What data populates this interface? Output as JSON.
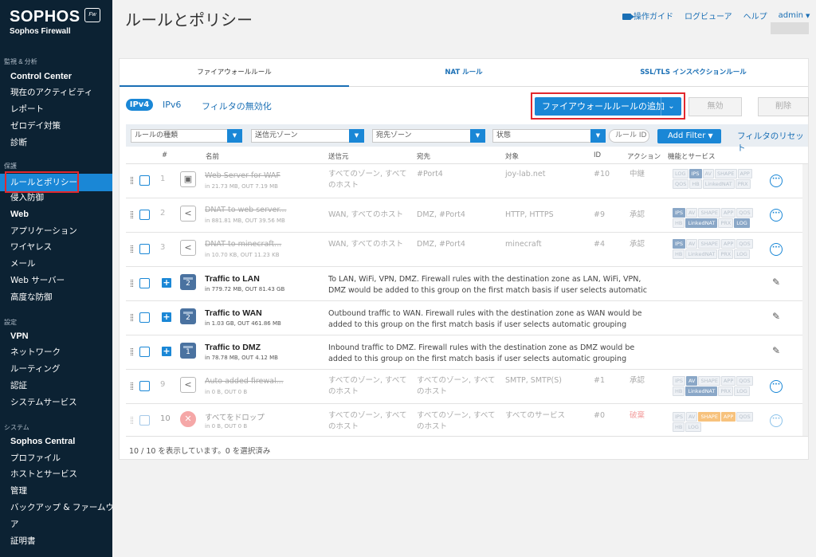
{
  "brand": {
    "name": "SOPHOS",
    "product": "Sophos Firewall",
    "badge": "Fw"
  },
  "sidebar": {
    "sections": [
      {
        "label": "監視 & 分析"
      },
      {
        "label": "保護"
      },
      {
        "label": "設定"
      },
      {
        "label": "システム"
      }
    ],
    "items": [
      {
        "label": "Control Center"
      },
      {
        "label": "現在のアクティビティ"
      },
      {
        "label": "レポート"
      },
      {
        "label": "ゼロデイ対策"
      },
      {
        "label": "診断"
      },
      {
        "label": "ルールとポリシー",
        "active": true
      },
      {
        "label": "侵入防御"
      },
      {
        "label": "Web"
      },
      {
        "label": "アプリケーション"
      },
      {
        "label": "ワイヤレス"
      },
      {
        "label": "メール"
      },
      {
        "label": "Web サーバー"
      },
      {
        "label": "高度な防御"
      },
      {
        "label": "VPN"
      },
      {
        "label": "ネットワーク"
      },
      {
        "label": "ルーティング"
      },
      {
        "label": "認証"
      },
      {
        "label": "システムサービス"
      },
      {
        "label": "Sophos Central"
      },
      {
        "label": "プロファイル"
      },
      {
        "label": "ホストとサービス"
      },
      {
        "label": "管理"
      },
      {
        "label": "バックアップ & ファームウェ"
      },
      {
        "label": "ア"
      },
      {
        "label": "証明書"
      }
    ]
  },
  "header": {
    "title": "ルールとポリシー",
    "links": [
      "操作ガイド",
      "ログビューア",
      "ヘルプ"
    ],
    "user": "admin"
  },
  "tabs": [
    {
      "label": "ファイアウォールルール",
      "active": true
    },
    {
      "label": "NAT ルール"
    },
    {
      "label": "SSL/TLS インスペクションルール"
    }
  ],
  "toolbar": {
    "ipv4": "IPv4",
    "ipv6": "IPv6",
    "disable_filter": "フィルタの無効化",
    "add_rule": "ファイアウォールルールの追加",
    "disable": "無効",
    "delete": "削除"
  },
  "filters": {
    "rule_type": "ルールの種類",
    "source_zone": "送信元ゾーン",
    "dest_zone": "宛先ゾーン",
    "status": "状態",
    "rule_id_placeholder": "ルール ID",
    "add_filter": "Add Filter",
    "reset": "フィルタのリセット"
  },
  "table": {
    "headers": {
      "num": "#",
      "name": "名前",
      "source": "送信元",
      "dest": "宛先",
      "target": "対象",
      "id": "ID",
      "action": "アクション",
      "features": "機能とサービス"
    },
    "rows": [
      {
        "num": "1",
        "name": "Web Server for WAF",
        "traffic": "in 21.73 MB, OUT 7.19 MB",
        "source": "すべてのゾーン, すべてのホスト",
        "dest": "#Port4",
        "target": "joy-lab.net",
        "id": "#10",
        "action": "中継",
        "badges": [
          "LOG",
          "IPS",
          "AV",
          "SHAPE",
          "APP",
          "QOS",
          "HB",
          "LinkedNAT",
          "PRX"
        ]
      },
      {
        "num": "2",
        "name": "DNAT to web server...",
        "traffic": "in 881.81 MB, OUT 39.56 MB",
        "source": "WAN, すべてのホスト",
        "dest": "DMZ, #Port4",
        "target": "HTTP, HTTPS",
        "id": "#9",
        "action": "承認",
        "badges": [
          "IPS",
          "AV",
          "SHAPE",
          "APP",
          "QOS",
          "HB",
          "LinkedNAT",
          "PRX",
          "LOG"
        ]
      },
      {
        "num": "3",
        "name": "DNAT to minecraft...",
        "traffic": "in 10.70 KB, OUT 11.23 KB",
        "source": "WAN, すべてのホスト",
        "dest": "DMZ, #Port4",
        "target": "minecraft",
        "id": "#4",
        "action": "承認",
        "badges": [
          "IPS",
          "AV",
          "SHAPE",
          "APP",
          "QOS",
          "HB",
          "LinkedNAT",
          "PRX",
          "LOG"
        ]
      },
      {
        "name": "Traffic to LAN",
        "traffic": "in 779.72 MB, OUT 81.43 GB",
        "group_count": "2",
        "desc": "To LAN, WiFi, VPN, DMZ. Firewall rules with the destination zone as LAN, WiFi, VPN, DMZ would be added to this group on the first match basis if user selects automatic grouping..."
      },
      {
        "name": "Traffic to WAN",
        "traffic": "in 1.03 GB, OUT 461.86 MB",
        "group_count": "2",
        "desc": "Outbound traffic to WAN. Firewall rules with the destination zone as WAN would be added to this group on the first match basis if user selects automatic grouping option. This is the d..."
      },
      {
        "name": "Traffic to DMZ",
        "traffic": "in 78.78 MB, OUT 4.12 MB",
        "group_count": "1",
        "desc": "Inbound traffic to DMZ. Firewall rules with the destination zone as DMZ would be added to this group on the first match basis if user selects automatic grouping option. This is the de..."
      },
      {
        "num": "9",
        "name": "Auto added firewal...",
        "traffic": "in 0 B, OUT 0 B",
        "source": "すべてのゾーン, すべてのホスト",
        "dest": "すべてのゾーン, すべてのホスト",
        "target": "SMTP, SMTP(S)",
        "id": "#1",
        "action": "承認",
        "badges": [
          "IPS",
          "AV",
          "SHAPE",
          "APP",
          "QOS",
          "HB",
          "LinkedNAT",
          "PRX",
          "LOG"
        ]
      },
      {
        "num": "10",
        "name": "すべてをドロップ",
        "traffic": "in 0 B, OUT 0 B",
        "source": "すべてのゾーン, すべてのホスト",
        "dest": "すべてのゾーン, すべてのホスト",
        "target": "すべてのサービス",
        "id": "#0",
        "action": "破棄",
        "badges": [
          "IPS",
          "AV",
          "SHAPE",
          "APP",
          "QOS",
          "HB",
          "LOG"
        ]
      }
    ]
  },
  "footer": {
    "status": "10 / 10 を表示しています。0 を選択済み"
  }
}
